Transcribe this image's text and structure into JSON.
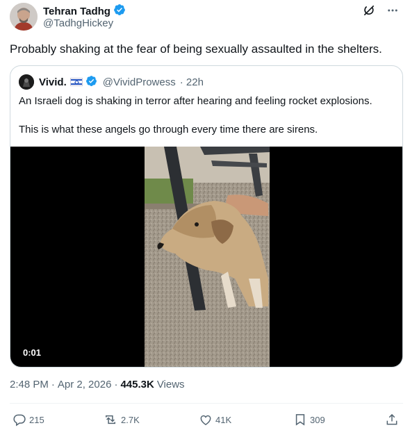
{
  "author": {
    "display_name": "Tehran Tadhg",
    "handle": "@TadhgHickey",
    "verified": true
  },
  "tweet": {
    "text": "Probably shaking at the fear of being sexually assaulted in the shelters."
  },
  "quoted": {
    "display_name": "Vivid.",
    "handle": "@VividProwess",
    "time": "· 22h",
    "line1": "An Israeli dog is shaking in terror after hearing and feeling rocket explosions.",
    "line2": "This is what these angels go through every time there are sirens.",
    "video_time": "0:01"
  },
  "meta": {
    "time": "2:48 PM",
    "date": "Apr 2, 2026",
    "views_count": "445.3K",
    "views_label": "Views"
  },
  "actions": {
    "replies": "215",
    "reposts": "2.7K",
    "likes": "41K",
    "bookmarks": "309"
  },
  "colors": {
    "verified": "#1d9bf0",
    "muted": "#536471",
    "border": "#cfd9de"
  },
  "icons": {
    "header": [
      "grok-icon",
      "more-icon"
    ],
    "actions": [
      "reply-icon",
      "repost-icon",
      "like-icon",
      "bookmark-icon",
      "share-icon"
    ]
  }
}
